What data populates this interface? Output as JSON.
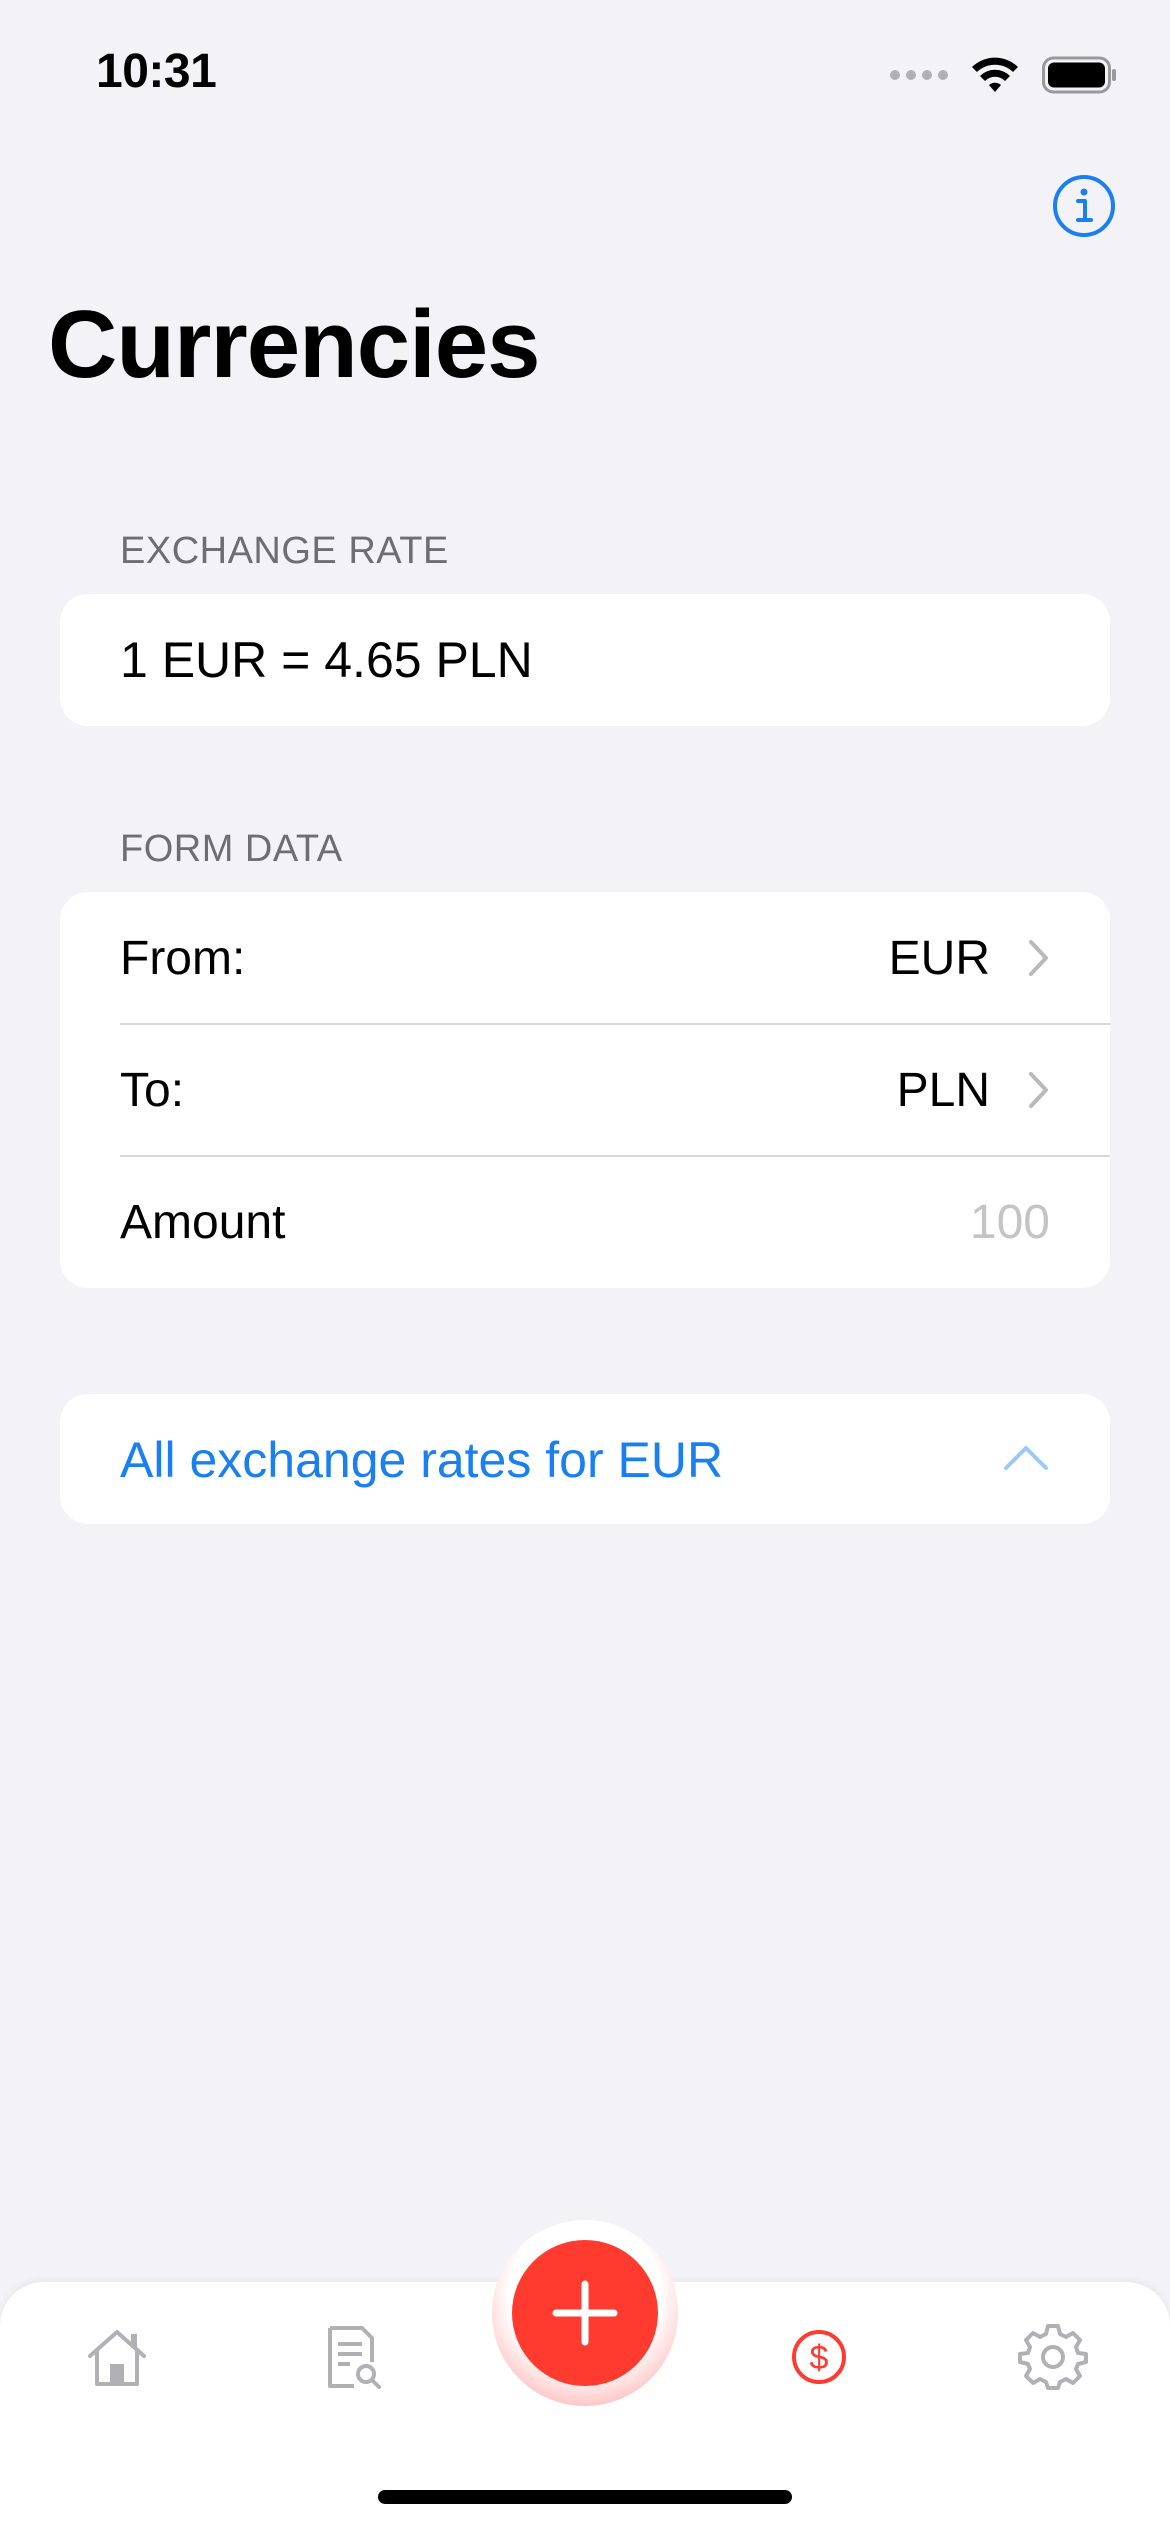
{
  "status_bar": {
    "time": "10:31"
  },
  "header": {
    "title": "Currencies"
  },
  "exchange_rate": {
    "section_title": "EXCHANGE RATE",
    "value": "1 EUR = 4.65 PLN"
  },
  "form": {
    "section_title": "FORM DATA",
    "from_label": "From:",
    "from_value": "EUR",
    "to_label": "To:",
    "to_value": "PLN",
    "amount_label": "Amount",
    "amount_placeholder": "100"
  },
  "all_rates": {
    "label": "All exchange rates for EUR"
  },
  "tab_bar": {
    "tabs": [
      {
        "icon": "house-icon",
        "active": false
      },
      {
        "icon": "document-search-icon",
        "active": false
      },
      {
        "icon": "plus-icon",
        "active": false
      },
      {
        "icon": "dollar-circle-icon",
        "active": true
      },
      {
        "icon": "gear-icon",
        "active": false
      }
    ]
  },
  "colors": {
    "accent": "#1a7ff0",
    "fab": "#ff3b30",
    "active_tab": "#ff3b30",
    "inactive_tab": "#b0b0b5",
    "background": "#f2f2f7"
  }
}
